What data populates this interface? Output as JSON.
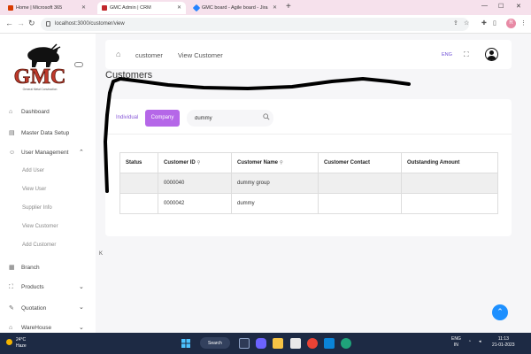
{
  "browser": {
    "tabs": [
      {
        "title": "Home | Microsoft 365",
        "active": false,
        "fav_color": "#d83b01"
      },
      {
        "title": "GMC Admin | CRM",
        "active": true,
        "fav_color": "#c1272d"
      },
      {
        "title": "GMC board - Agile board - Jira",
        "active": false,
        "fav_color": "#2684ff"
      }
    ],
    "url": "localhost:3000/customer/view",
    "profile_initial": "R"
  },
  "sidebar": {
    "logo_text": "GMC",
    "logo_subtext": "General Metal Construction",
    "items": [
      {
        "label": "Dashboard",
        "icon": "home-icon"
      },
      {
        "label": "Master Data Setup",
        "icon": "layers-icon"
      },
      {
        "label": "User Management",
        "icon": "user-icon"
      },
      {
        "label": "Branch",
        "icon": "building-icon"
      },
      {
        "label": "Products",
        "icon": "cart-icon"
      },
      {
        "label": "Quotation",
        "icon": "quotation-icon"
      },
      {
        "label": "WareHouse",
        "icon": "warehouse-icon"
      }
    ],
    "sub_items": [
      "Add User",
      "View User",
      "Supplier Info",
      "View Customer",
      "Add Customer"
    ]
  },
  "header": {
    "breadcrumb": [
      "customer",
      "View Customer"
    ],
    "lang": "ENG"
  },
  "page": {
    "title": "Customers",
    "toggle_individual": "Individual",
    "toggle_company": "Company",
    "search_value": "dummy",
    "columns": [
      "Status",
      "Customer ID",
      "Customer Name",
      "Customer Contact",
      "Outstanding Amount"
    ],
    "rows": [
      {
        "status": "",
        "id": "0000040",
        "name": "dummy group",
        "contact": "",
        "amount": ""
      },
      {
        "status": "",
        "id": "0000042",
        "name": "dummy",
        "contact": "",
        "amount": ""
      }
    ],
    "stray_char": "K"
  },
  "taskbar": {
    "weather_temp": "24°C",
    "weather_desc": "Haze",
    "search_label": "Search",
    "lang_top": "ENG",
    "lang_bottom": "IN",
    "time": "11:13",
    "date": "21-01-2023"
  }
}
